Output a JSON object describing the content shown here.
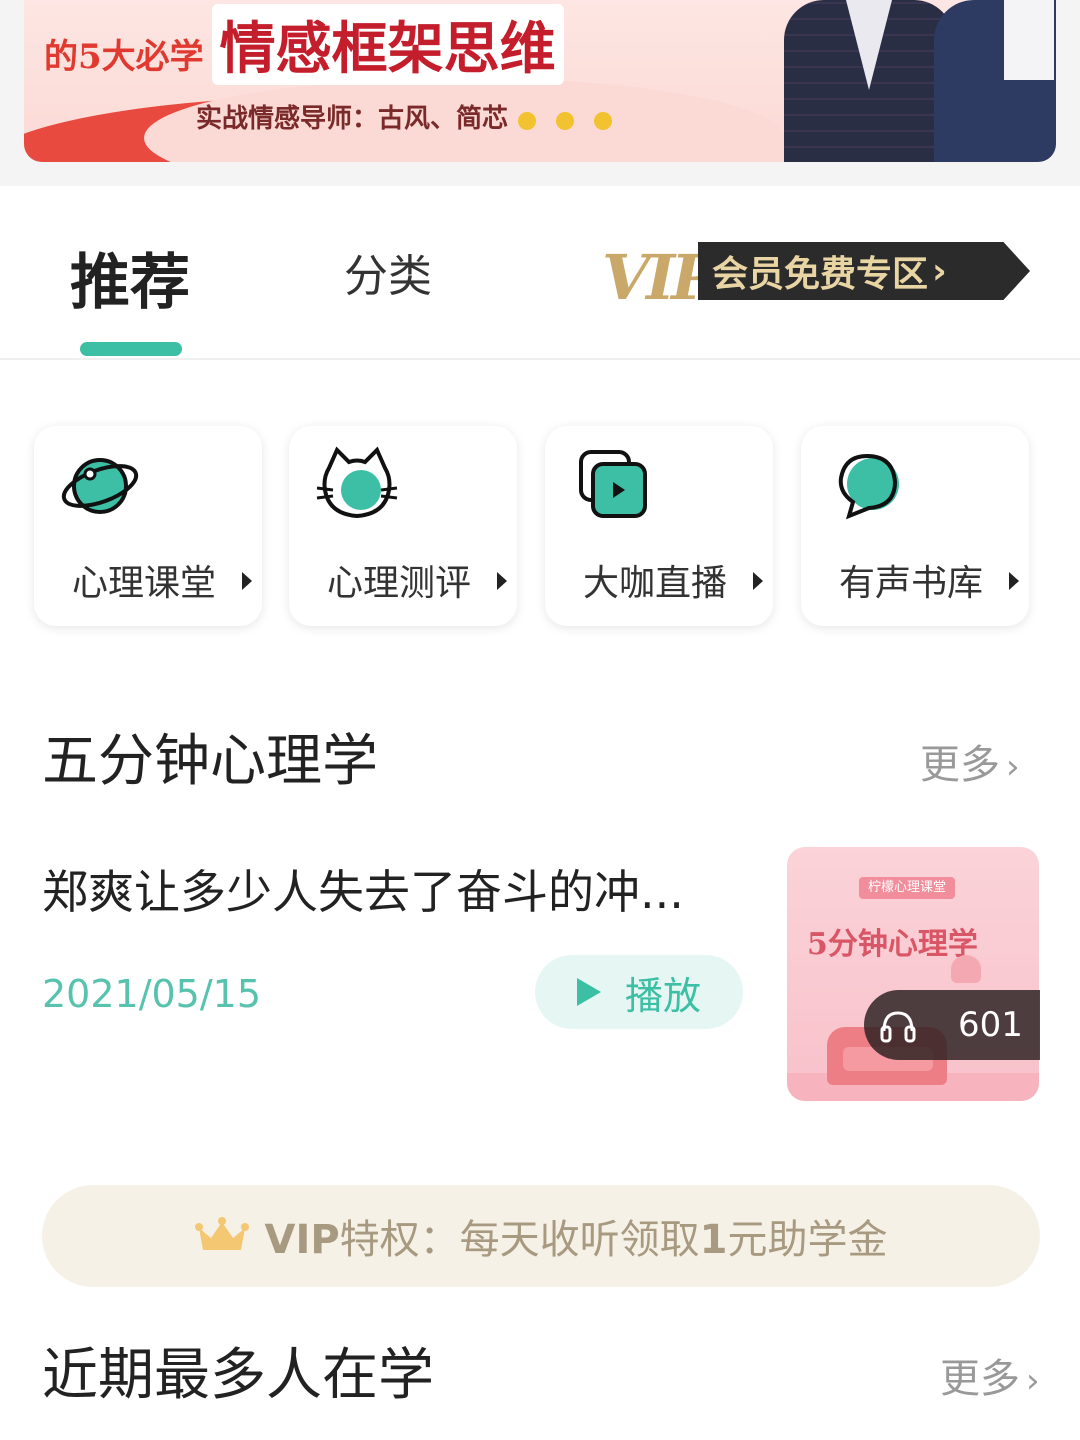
{
  "banner": {
    "prefix": "的5大必学",
    "headline": "情感框架思维",
    "mentors": "实战情感导师：古风、简芯"
  },
  "tabs": {
    "recommend": "推荐",
    "category": "分类",
    "vip_mark": "VIP",
    "vip_zone": "会员免费专区",
    "vip_chevron": "›"
  },
  "quick_cards": [
    {
      "label": "心理课堂",
      "icon": "planet-icon"
    },
    {
      "label": "心理测评",
      "icon": "cat-icon"
    },
    {
      "label": "大咖直播",
      "icon": "video-play-icon"
    },
    {
      "label": "有声书库",
      "icon": "chat-bubble-icon"
    }
  ],
  "five_min": {
    "title": "五分钟心理学",
    "more": "更多",
    "more_chevron": "›",
    "item": {
      "title": "郑爽让多少人失去了奋斗的冲...",
      "date": "2021/05/15",
      "play_label": "播放",
      "thumb_brand": "柠檬心理课堂",
      "thumb_title": "5分钟心理学",
      "listen_count": "601"
    }
  },
  "vip_privilege": {
    "prefix": "VIP",
    "text": "特权：每天收听领取",
    "amount": "1",
    "suffix": "元助学金"
  },
  "popular": {
    "title": "近期最多人在学",
    "more": "更多",
    "more_chevron": "›"
  },
  "colors": {
    "accent": "#3cbfa5",
    "accent_light": "#e6f6f2",
    "vip_gold": "#c9a86a",
    "vip_bg": "#f6f1e7",
    "muted": "#999999"
  }
}
